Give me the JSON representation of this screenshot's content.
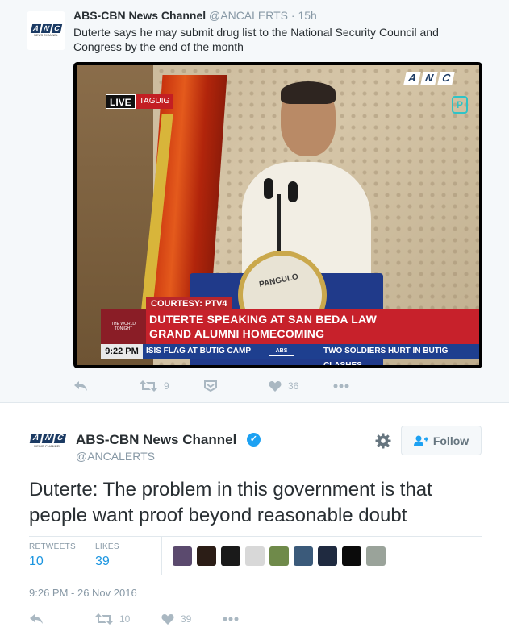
{
  "quoted_tweet": {
    "avatar_logo": [
      "A",
      "N",
      "C"
    ],
    "avatar_subtext": "NEWS CHANNEL",
    "display_name": "ABS-CBN News Channel",
    "handle": "@ANCALERTS",
    "separator": "·",
    "time": "15h",
    "text": "Duterte says he may submit drug list to the National Security Council and Congress by the end of the month",
    "media": {
      "screen_logo": [
        "A",
        "N",
        "C"
      ],
      "corner_bug": "P",
      "live_label": "LIVE",
      "location_label": "TAGUIG",
      "courtesy": "COURTESY: PTV4",
      "box_text": "THE WORLD TONIGHT",
      "headline_line1": "DUTERTE SPEAKING AT SAN BEDA LAW",
      "headline_line2": "GRAND ALUMNI HOMECOMING",
      "ticker_time": "9:22 PM",
      "ticker_left": "ISIS FLAG AT BUTIG CAMP",
      "ticker_mid": "ABS",
      "ticker_right": "TWO SOLDIERS HURT IN BUTIG CLASHES",
      "seal_text": "PANGULO"
    },
    "actions": {
      "reply_icon": "reply-icon",
      "retweet_icon": "retweet-icon",
      "retweet_count": "9",
      "dm_icon": "direct-message-icon",
      "like_icon": "heart-icon",
      "like_count": "36",
      "more_icon": "more-icon"
    }
  },
  "main_tweet": {
    "avatar_logo": [
      "A",
      "N",
      "C"
    ],
    "avatar_subtext": "NEWS CHANNEL",
    "display_name": "ABS-CBN News Channel",
    "verified_icon": "verified-badge-icon",
    "handle": "@ANCALERTS",
    "settings_icon": "gear-icon",
    "follow_label": "Follow",
    "text": "Duterte: The problem in this government is that people want proof beyond reasonable doubt",
    "stats": {
      "retweets_label": "RETWEETS",
      "retweets_value": "10",
      "likes_label": "LIKES",
      "likes_value": "39"
    },
    "liker_colors": [
      "#5b4a6e",
      "#2b1d16",
      "#1a1a1a",
      "#d8d8d8",
      "#6f8a4a",
      "#3b5a7a",
      "#1f2a40",
      "#0b0b0b",
      "#9aa39a"
    ],
    "timestamp": "9:26 PM - 26 Nov 2016",
    "actions": {
      "reply_icon": "reply-icon",
      "retweet_icon": "retweet-icon",
      "retweet_count": "10",
      "like_icon": "heart-icon",
      "like_count": "39",
      "more_icon": "more-icon"
    }
  },
  "colors": {
    "link_blue": "#1b95e0",
    "muted_text": "#8899a6",
    "icon_gray": "#aab8c2",
    "verified_blue": "#1da1f2",
    "anc_navy": "#1b3a63"
  }
}
